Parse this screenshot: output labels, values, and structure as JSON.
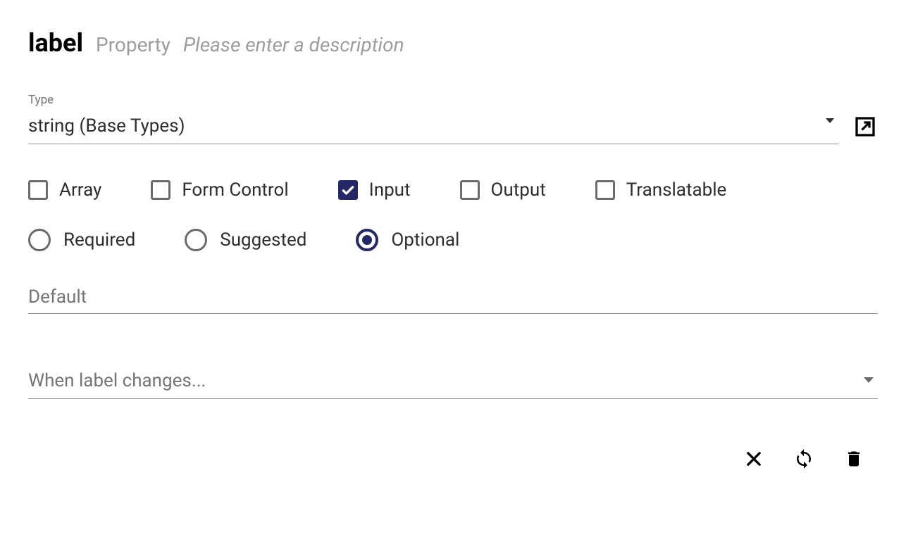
{
  "header": {
    "title": "label",
    "subtitle": "Property",
    "description_placeholder": "Please enter a description"
  },
  "type_field": {
    "label": "Type",
    "value": "string (Base Types)"
  },
  "checkboxes": {
    "array": {
      "label": "Array",
      "checked": false
    },
    "form_control": {
      "label": "Form Control",
      "checked": false
    },
    "input": {
      "label": "Input",
      "checked": true
    },
    "output": {
      "label": "Output",
      "checked": false
    },
    "translatable": {
      "label": "Translatable",
      "checked": false
    }
  },
  "radios": {
    "required": {
      "label": "Required",
      "selected": false
    },
    "suggested": {
      "label": "Suggested",
      "selected": false
    },
    "optional": {
      "label": "Optional",
      "selected": true
    }
  },
  "default_field": {
    "placeholder": "Default",
    "value": ""
  },
  "when_changes_field": {
    "placeholder": "When label changes...",
    "value": ""
  },
  "icons": {
    "open_in_new": "open-in-new-icon",
    "close": "close-icon",
    "refresh": "refresh-icon",
    "delete": "delete-icon"
  }
}
